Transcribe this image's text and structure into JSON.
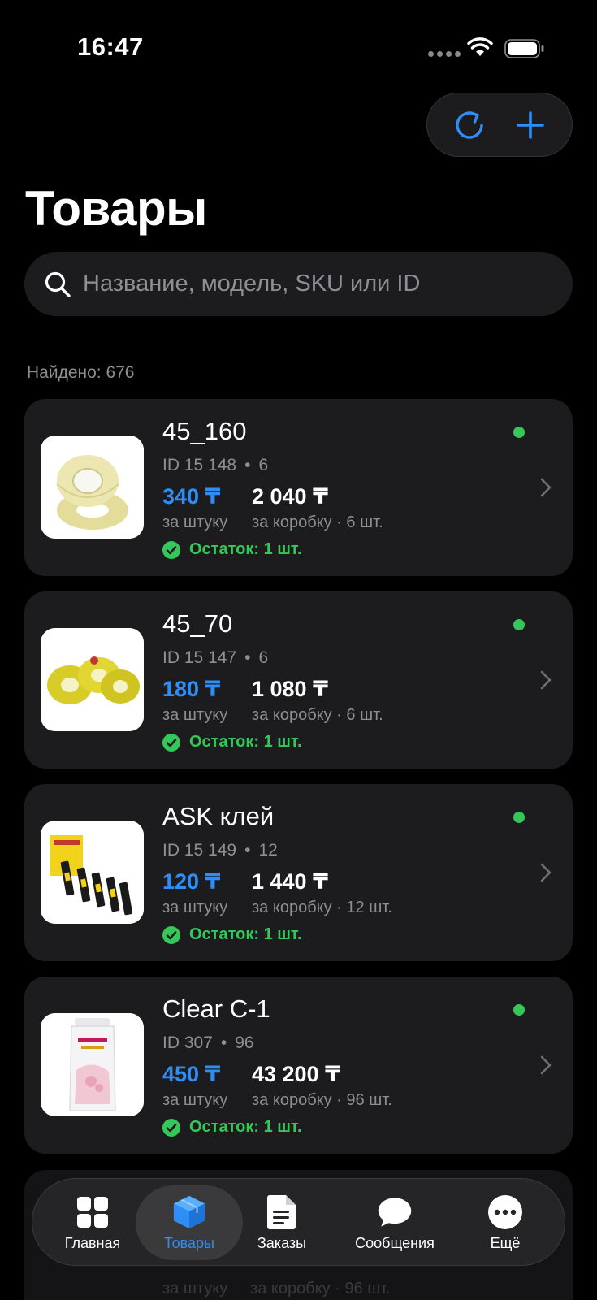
{
  "status_bar": {
    "time": "16:47"
  },
  "header": {
    "title": "Товары",
    "refresh_icon": "refresh-icon",
    "add_icon": "plus-icon"
  },
  "search": {
    "placeholder": "Название, модель, SKU или ID",
    "value": ""
  },
  "found_text": "Найдено: 676",
  "colors": {
    "accent": "#2f8ef5",
    "success": "#34c759",
    "card": "#1c1c1e",
    "secondary": "#8e8e93"
  },
  "products": [
    {
      "name": "45_160",
      "id": "ID 15 148",
      "pack": "6",
      "price_unit": "340 ₸",
      "price_box": "2 040 ₸",
      "label_unit": "за штуку",
      "label_box": "за коробку · 6 шт.",
      "stock": "Остаток: 1 шт.",
      "image": "tape-clear-icon"
    },
    {
      "name": "45_70",
      "id": "ID 15 147",
      "pack": "6",
      "price_unit": "180 ₸",
      "price_box": "1 080 ₸",
      "label_unit": "за штуку",
      "label_box": "за коробку · 6 шт.",
      "stock": "Остаток: 1 шт.",
      "image": "tape-yellow-icon"
    },
    {
      "name": "ASK клей",
      "id": "ID 15 149",
      "pack": "12",
      "price_unit": "120 ₸",
      "price_box": "1 440 ₸",
      "label_unit": "за штуку",
      "label_box": "за коробку · 12 шт.",
      "stock": "Остаток: 1 шт.",
      "image": "glue-tubes-icon"
    },
    {
      "name": "Clear C-1",
      "id": "ID 307",
      "pack": "96",
      "price_unit": "450 ₸",
      "price_box": "43 200 ₸",
      "label_unit": "за штуку",
      "label_box": "за коробку · 96 шт.",
      "stock": "Остаток: 1 шт.",
      "image": "shampoo-bottle-icon"
    }
  ],
  "ghost_row": {
    "label_unit": "за штуку",
    "label_box": "за коробку · 96 шт."
  },
  "tabs": [
    {
      "label": "Главная",
      "icon": "grid-icon",
      "active": false
    },
    {
      "label": "Товары",
      "icon": "box-icon",
      "active": true
    },
    {
      "label": "Заказы",
      "icon": "document-icon",
      "active": false
    },
    {
      "label": "Сообщения",
      "icon": "chat-bubble-icon",
      "active": false
    },
    {
      "label": "Ещё",
      "icon": "more-icon",
      "active": false
    }
  ]
}
